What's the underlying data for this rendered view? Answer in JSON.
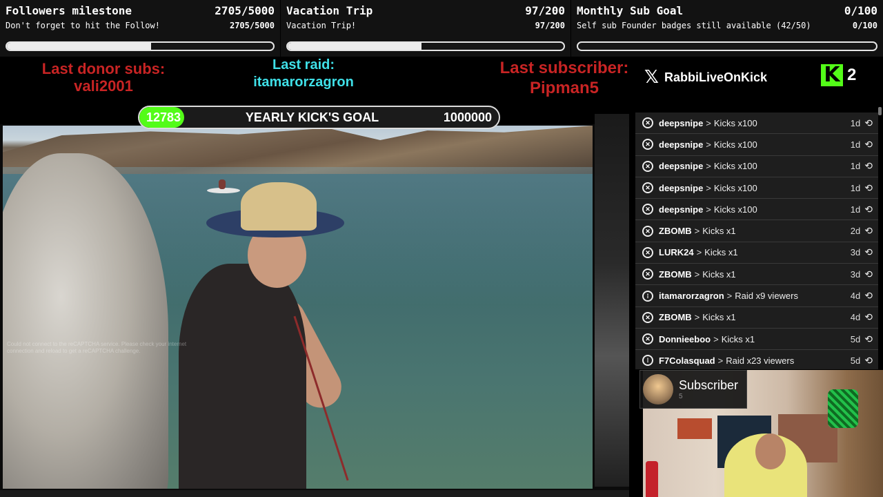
{
  "goals": [
    {
      "title": "Followers milestone",
      "title_value": "2705/5000",
      "subtitle": "Don't forget to hit the Follow!",
      "subtitle_value": "2705/5000",
      "progress": 0.541
    },
    {
      "title": "Vacation Trip",
      "title_value": "97/200",
      "subtitle": "Vacation Trip!",
      "subtitle_value": "97/200",
      "progress": 0.485
    },
    {
      "title": "Monthly Sub Goal",
      "title_value": "0/100",
      "subtitle": "Self sub Founder badges still available (42/50)",
      "subtitle_value": "0/100",
      "progress": 0
    }
  ],
  "last_donor": {
    "label": "Last donor subs:",
    "name": "vali2001"
  },
  "last_raid": {
    "label": "Last raid:",
    "name": "itamarorzagron"
  },
  "last_subscriber": {
    "label": "Last subscriber:",
    "name": "Pipman5"
  },
  "social": {
    "icon": "x-logo-icon",
    "handle": "RabbiLiveOnKick"
  },
  "kick": {
    "icon": "kick-logo-icon",
    "count": "2",
    "brand_color": "#53fc18"
  },
  "yearly_goal": {
    "current": "12783",
    "label": "YEARLY KICK'S GOAL",
    "target": "1000000",
    "progress": 0.012783
  },
  "captcha_text": "Could not connect to the reCAPTCHA service. Please check your internet connection and reload to get a reCAPTCHA challenge.",
  "feed": [
    {
      "icon": "kick-icon",
      "user": "deepsnipe",
      "action": "Kicks x100",
      "ago": "1d"
    },
    {
      "icon": "kick-icon",
      "user": "deepsnipe",
      "action": "Kicks x100",
      "ago": "1d"
    },
    {
      "icon": "kick-icon",
      "user": "deepsnipe",
      "action": "Kicks x100",
      "ago": "1d"
    },
    {
      "icon": "kick-icon",
      "user": "deepsnipe",
      "action": "Kicks x100",
      "ago": "1d"
    },
    {
      "icon": "kick-icon",
      "user": "deepsnipe",
      "action": "Kicks x100",
      "ago": "1d"
    },
    {
      "icon": "kick-icon",
      "user": "ZBOMB",
      "action": "Kicks x1",
      "ago": "2d"
    },
    {
      "icon": "kick-icon",
      "user": "LURK24",
      "action": "Kicks x1",
      "ago": "3d"
    },
    {
      "icon": "kick-icon",
      "user": "ZBOMB",
      "action": "Kicks x1",
      "ago": "3d"
    },
    {
      "icon": "raid-icon",
      "user": "itamarorzagron",
      "action": "Raid x9 viewers",
      "ago": "4d"
    },
    {
      "icon": "kick-icon",
      "user": "ZBOMB",
      "action": "Kicks x1",
      "ago": "4d"
    },
    {
      "icon": "kick-icon",
      "user": "Donnieeboo",
      "action": "Kicks x1",
      "ago": "5d"
    },
    {
      "icon": "raid-icon",
      "user": "F7Colasquad",
      "action": "Raid x23 viewers",
      "ago": "5d"
    }
  ],
  "subscriber_card": {
    "title": "Subscriber",
    "count": "5"
  }
}
